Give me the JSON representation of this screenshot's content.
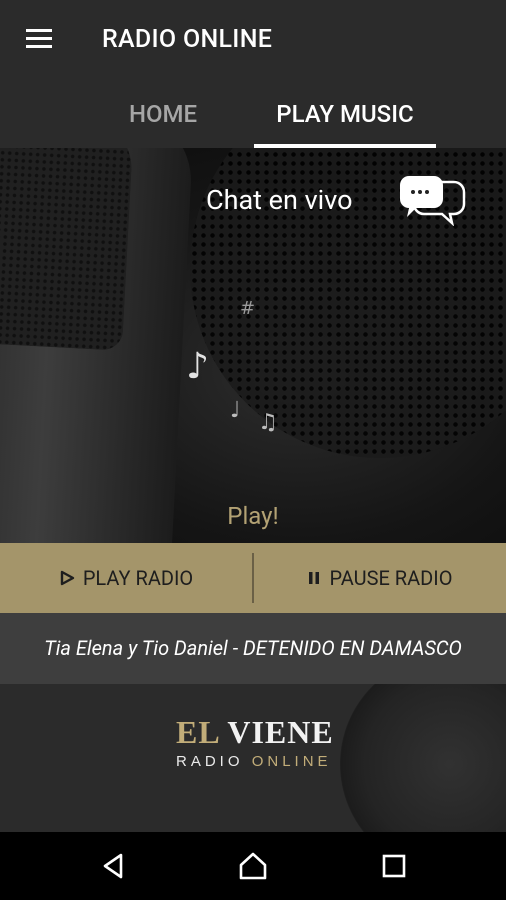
{
  "app": {
    "title": "RADIO ONLINE",
    "menu_icon": "hamburger-menu-icon"
  },
  "tabs": [
    {
      "label": "HOME",
      "active": false
    },
    {
      "label": "PLAY MUSIC",
      "active": true
    }
  ],
  "hero": {
    "chat_label": "Chat en vivo",
    "chat_icon": "chat-bubbles-icon",
    "status": "Play!",
    "notes": [
      "♪",
      "♩",
      "♫",
      "#"
    ]
  },
  "controls": {
    "play_label": "PLAY RADIO",
    "play_icon": "play-icon",
    "pause_label": "PAUSE RADIO",
    "pause_icon": "pause-icon",
    "accent_color": "#a4956a"
  },
  "now_playing": {
    "text": "Tia Elena y Tio Daniel - DETENIDO EN DAMASCO"
  },
  "logo": {
    "word1": "EL",
    "word2": "VIENE",
    "sub1": "RADIO",
    "sub2": "ONLINE",
    "gold_color": "#c2ad79"
  },
  "navbar": {
    "back_icon": "back-triangle-icon",
    "home_icon": "home-icon",
    "recent_icon": "recent-apps-icon"
  }
}
